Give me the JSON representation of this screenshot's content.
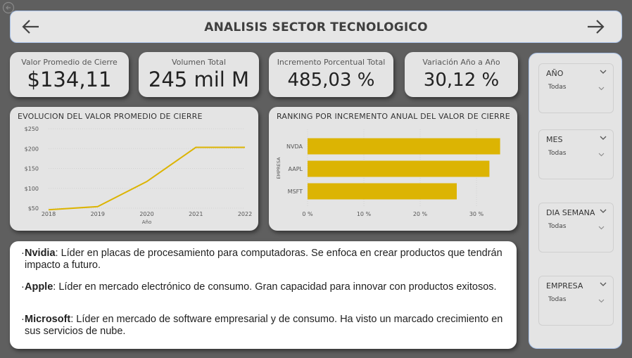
{
  "header": {
    "title": "ANALISIS SECTOR TECNOLOGICO"
  },
  "kpis": [
    {
      "label": "Valor Promedio de Cierre",
      "value": "$134,11"
    },
    {
      "label": "Volumen Total",
      "value": "245 mil M"
    },
    {
      "label": "Incremento Porcentual Total",
      "value": "485,03 %"
    },
    {
      "label": "Variación Año a Año",
      "value": "30,12 %"
    }
  ],
  "line_chart": {
    "title": "EVOLUCION DEL VALOR PROMEDIO DE CIERRE",
    "xlabel": "Año"
  },
  "bar_chart": {
    "title": "RANKING POR INCREMENTO ANUAL DEL VALOR DE CIERRE",
    "ylabel": "EMPRESA"
  },
  "chart_data": [
    {
      "type": "line",
      "title": "EVOLUCION DEL VALOR PROMEDIO DE CIERRE",
      "xlabel": "Año",
      "ylabel": "",
      "x": [
        2018,
        2019,
        2020,
        2021,
        2022
      ],
      "series": [
        {
          "values": [
            46,
            54,
            117,
            203,
            203
          ]
        }
      ],
      "yticks": [
        "$50",
        "$100",
        "$150",
        "$200",
        "$250"
      ],
      "ytick_values": [
        50,
        100,
        150,
        200,
        250
      ],
      "ylim": [
        50,
        250
      ],
      "color": "#dcb403"
    },
    {
      "type": "bar",
      "orientation": "horizontal",
      "title": "RANKING POR INCREMENTO ANUAL DEL VALOR DE CIERRE",
      "ylabel": "EMPRESA",
      "categories": [
        "NVDA",
        "AAPL",
        "MSFT"
      ],
      "values": [
        34.2,
        32.3,
        26.5
      ],
      "xticks": [
        "0 %",
        "10 %",
        "20 %",
        "30 %"
      ],
      "xtick_values": [
        0,
        10,
        20,
        30
      ],
      "xlim": [
        0,
        30
      ],
      "color": "#dcb403"
    }
  ],
  "notes": [
    {
      "name": "Nvidia",
      "text": ": Líder en placas de procesamiento para computadoras. Se enfoca en crear productos que tendrán impacto a futuro."
    },
    {
      "name": "Apple",
      "text": ": Líder en mercado electrónico de consumo. Gran capacidad para innovar con productos exitosos."
    },
    {
      "name": "Microsoft",
      "text": ": Líder en mercado de software empresarial y de consumo. Ha visto un marcado crecimiento en sus servicios de nube."
    }
  ],
  "slicers": [
    {
      "label": "AÑO",
      "value": "Todas"
    },
    {
      "label": "MES",
      "value": "Todas"
    },
    {
      "label": "DIA SEMANA",
      "value": "Todas"
    },
    {
      "label": "EMPRESA",
      "value": "Todas"
    }
  ],
  "icons": {
    "back": "arrow-left-icon",
    "forward": "arrow-right-icon",
    "corner": "back-circle-icon",
    "dropdown": "chevron-down-icon"
  }
}
